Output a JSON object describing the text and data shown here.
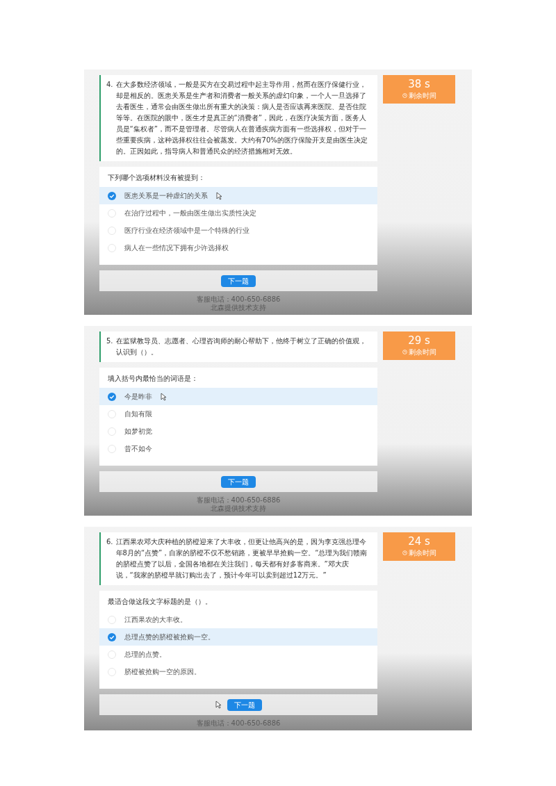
{
  "panels": [
    {
      "number": "4.",
      "question": "在大多数经济领域，一般是买方在交易过程中起主导作用，然而在医疗保健行业，却是相反的。医患关系是生产者和消费者一般关系的虚幻印象，一个人一旦选择了去看医生，通常会由医生做出所有重大的决策：病人是否应该再来医院、是否住院等等。在医院的眼中，医生才是真正的“消费者”，因此，在医疗决策方面，医务人员是“集权者”，而不是管理者。尽管病人在普通疾病方面有一些选择权，但对于一些重要疾病，这种选择权往往会被蒸发。大约有70%的医疗保险开支是由医生决定的。正因如此，指导病人和普通民众的经济措施相对无效。",
      "timer": {
        "value": "38 s",
        "label": "剩余时间"
      },
      "prompt": "下列哪个选项材料没有被提到：",
      "options": [
        {
          "text": "医患关系是一种虚幻的关系",
          "selected": true
        },
        {
          "text": "在治疗过程中，一般由医生做出实质性决定",
          "selected": false
        },
        {
          "text": "医疗行业在经济领域中是一个特殊的行业",
          "selected": false
        },
        {
          "text": "病人在一些情况下拥有少许选择权",
          "selected": false
        }
      ],
      "cursor_at_button": false,
      "button": "下一题",
      "footer": [
        "客服电话：400-650-6886",
        "北森提供技术支持"
      ]
    },
    {
      "number": "5.",
      "question": "在监狱教导员、志愿者、心理咨询师的耐心帮助下，他终于树立了正确的价值观，认识到（）。",
      "timer": {
        "value": "29 s",
        "label": "剩余时间"
      },
      "prompt": "填入括号内最恰当的词语是：",
      "options": [
        {
          "text": "今是昨非",
          "selected": true
        },
        {
          "text": "自知有限",
          "selected": false
        },
        {
          "text": "如梦初觉",
          "selected": false
        },
        {
          "text": "昔不如今",
          "selected": false
        }
      ],
      "cursor_at_button": false,
      "button": "下一题",
      "footer": [
        "客服电话：400-650-6886",
        "北森提供技术支持"
      ]
    },
    {
      "number": "6.",
      "question": "江西果农邓大庆种植的脐橙迎来了大丰收，但更让他高兴的是，因为李克强总理今年8月的“点赞”，自家的脐橙不仅不愁销路，更被早早抢购一空。“总理为我们赣南的脐橙点赞了以后，全国各地都在关注我们，每天都有好多客商来。”邓大庆说，“我家的脐橙早就订购出去了，预计今年可以卖到超过12万元。”",
      "timer": {
        "value": "24 s",
        "label": "剩余时间"
      },
      "prompt": "最适合做这段文字标题的是（）。",
      "options": [
        {
          "text": "江西果农的大丰收。",
          "selected": false
        },
        {
          "text": "总理点赞的脐橙被抢购一空。",
          "selected": true
        },
        {
          "text": "总理的点赞。",
          "selected": false
        },
        {
          "text": "脐橙被抢购一空的原因。",
          "selected": false
        }
      ],
      "cursor_at_button": true,
      "button": "下一题",
      "footer": [
        "客服电话：400-650-6886"
      ]
    }
  ]
}
